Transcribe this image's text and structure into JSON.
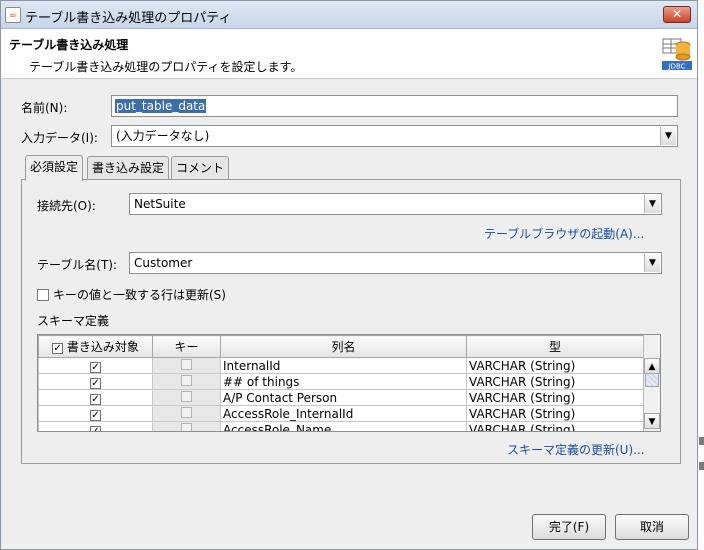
{
  "window": {
    "title": "テーブル書き込み処理のプロパティ",
    "close": "✕"
  },
  "header": {
    "title": "テーブル書き込み処理",
    "description": "テーブル書き込み処理のプロパティを設定します。",
    "icon_label": "JDBC"
  },
  "fields": {
    "name_label": "名前(N):",
    "name_value": "put_table_data",
    "input_label": "入力データ(I):",
    "input_value": "(入力データなし)"
  },
  "tabs": [
    {
      "label": "必須設定",
      "active": true
    },
    {
      "label": "書き込み設定"
    },
    {
      "label": "コメント"
    }
  ],
  "required": {
    "connection_label": "接続先(O):",
    "connection_value": "NetSuite",
    "table_browser_link": "テーブルブラウザの起動(A)...",
    "table_label": "テーブル名(T):",
    "table_value": "Customer",
    "update_label": "キーの値と一致する行は更新(S)",
    "schema_label": "スキーマ定義",
    "schema_update_link": "スキーマ定義の更新(U)..."
  },
  "schema": {
    "columns": [
      "書き込み対象",
      "キー",
      "列名",
      "型"
    ],
    "rows": [
      {
        "write": true,
        "key": false,
        "name": "InternalId",
        "type": "VARCHAR (String)"
      },
      {
        "write": true,
        "key": false,
        "name": "## of things",
        "type": "VARCHAR (String)"
      },
      {
        "write": true,
        "key": false,
        "name": "A/P Contact Person",
        "type": "VARCHAR (String)"
      },
      {
        "write": true,
        "key": false,
        "name": "AccessRole_InternalId",
        "type": "VARCHAR (String)"
      },
      {
        "write": true,
        "key": false,
        "name": "AccessRole_Name",
        "type": "VARCHAR (String)"
      }
    ]
  },
  "buttons": {
    "finish": "完了(F)",
    "cancel": "取消"
  },
  "icons": {
    "check": "✓",
    "dropdown": "▼",
    "scroll_up": "▲",
    "scroll_down": "▼"
  }
}
